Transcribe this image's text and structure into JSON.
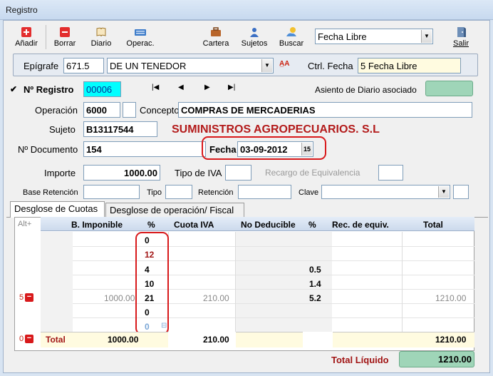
{
  "window": {
    "title": "Registro"
  },
  "toolbar": {
    "add": "Añadir",
    "delete": "Borrar",
    "journal": "Diario",
    "operations": "Operac.",
    "portfolio": "Cartera",
    "subjects": "Sujetos",
    "search": "Buscar",
    "date_mode": "Fecha Libre",
    "exit": "Salir"
  },
  "header": {
    "epigrafe_label": "Epígrafe",
    "epigrafe_code": "671.5",
    "epigrafe_desc": "DE UN TENEDOR",
    "ctrl_fecha_label": "Ctrl. Fecha",
    "ctrl_fecha_value": "5 Fecha Libre"
  },
  "record": {
    "check": "✔",
    "num_label": "Nº Registro",
    "num_value": "00006",
    "nav_first": "|◀",
    "nav_prev": "◀",
    "nav_next": "▶",
    "nav_last": "▶|",
    "asiento_label": "Asiento de Diario asociado",
    "operacion_label": "Operación",
    "operacion_value": "6000",
    "concepto_label": "Concepto",
    "concepto_value": "COMPRAS DE MERCADERIAS",
    "sujeto_label": "Sujeto",
    "sujeto_value": "B13117544",
    "sujeto_name": "SUMINISTROS AGROPECUARIOS. S.L",
    "documento_label": "Nº Documento",
    "documento_value": "154",
    "fecha_label": "Fecha",
    "fecha_value": "03-09-2012",
    "importe_label": "Importe",
    "importe_value": "1000.00",
    "tipo_iva_label": "Tipo de IVA",
    "tipo_iva_value": "",
    "recargo_label": "Recargo de Equivalencia",
    "base_ret_label": "Base Retención",
    "tipo_label": "Tipo",
    "retencion_label": "Retención",
    "clave_label": "Clave"
  },
  "tabs": [
    "Desglose de Cuotas",
    "Desglose de operación/ Fiscal"
  ],
  "grid": {
    "alt_label": "Alt+",
    "headers": [
      "B. Imponible",
      "%",
      "Cuota IVA",
      "No Deducible",
      "%",
      "Rec. de equiv.",
      "Total"
    ],
    "rows": [
      {
        "pct": "0",
        "re_pct": ""
      },
      {
        "pct": "12",
        "re_pct": ""
      },
      {
        "pct": "4",
        "re_pct": "0.5"
      },
      {
        "pct": "10",
        "re_pct": "1.4"
      },
      {
        "pct": "21",
        "re_pct": "5.2",
        "base": "1000.00",
        "cuota": "210.00",
        "total": "1210.00",
        "row_count": "5"
      },
      {
        "pct": "0",
        "re_pct": ""
      },
      {
        "pct": "0",
        "re_pct": ""
      }
    ],
    "total_row": {
      "count": "0",
      "label": "Total",
      "base": "1000.00",
      "cuota": "210.00",
      "total": "1210.00"
    }
  },
  "footer": {
    "total_liquido_label": "Total Líquido",
    "total_liquido_value": "1210.00"
  },
  "colors": {
    "accent_red": "#d8191b",
    "brand_red": "#b31b1b",
    "green_field": "#9fd5b8",
    "cyan_field": "#00ffff"
  }
}
